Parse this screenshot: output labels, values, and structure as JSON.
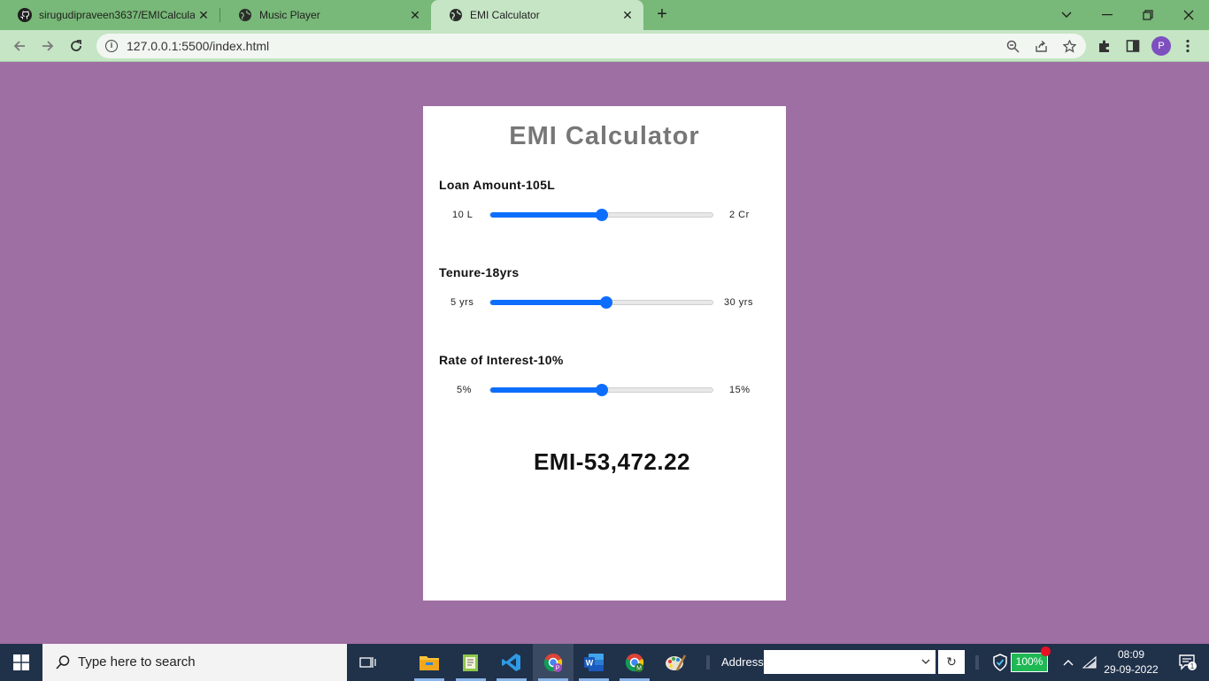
{
  "browser": {
    "tabs": [
      {
        "title": "sirugudipraveen3637/EMICalcula",
        "icon": "github-icon",
        "active": false
      },
      {
        "title": "Music Player",
        "icon": "globe-icon",
        "active": false
      },
      {
        "title": "EMI Calculator",
        "icon": "globe-icon",
        "active": true
      }
    ],
    "url": "127.0.0.1:5500/index.html",
    "profile_initial": "P"
  },
  "app": {
    "title": "EMI Calculator",
    "sliders": [
      {
        "label": "Loan Amount-105L",
        "min_label": "10 L",
        "max_label": "2 Cr",
        "value": 105,
        "min": 10,
        "max": 200
      },
      {
        "label": "Tenure-18yrs",
        "min_label": "5 yrs",
        "max_label": "30 yrs",
        "value": 18,
        "min": 5,
        "max": 30
      },
      {
        "label": "Rate of Interest-10%",
        "min_label": "5%",
        "max_label": "15%",
        "value": 10,
        "min": 5,
        "max": 15
      }
    ],
    "emi_text": "EMI-53,472.22",
    "accent": "#0d6efd",
    "background": "#9e6fa2"
  },
  "taskbar": {
    "search_placeholder": "Type here to search",
    "address_label": "Address",
    "battery": "100%",
    "time": "08:09",
    "date": "29-09-2022",
    "notification_count": "1"
  }
}
